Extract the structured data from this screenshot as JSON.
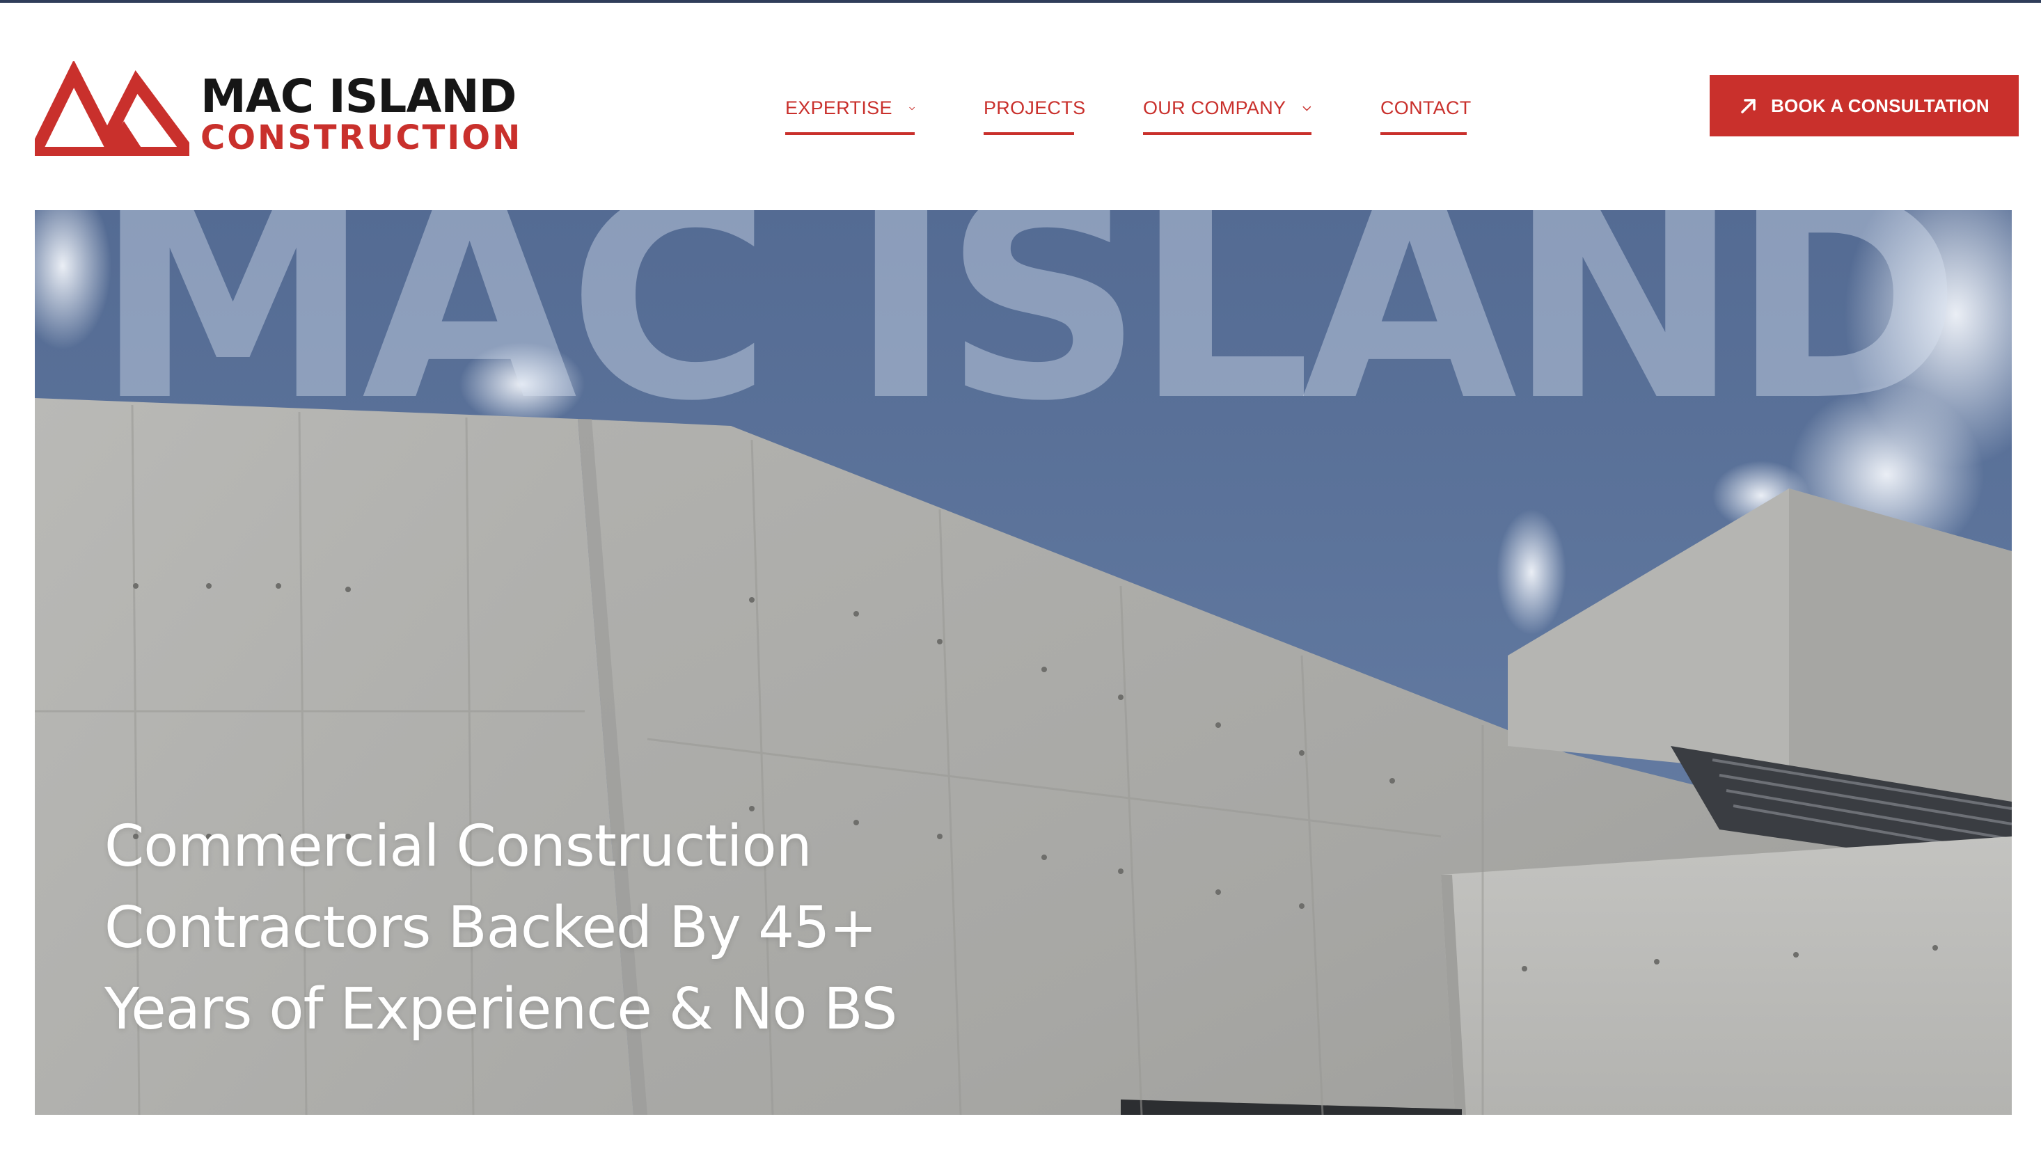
{
  "brand": {
    "name_line1": "MAC ISLAND",
    "name_line2": "CONSTRUCTION",
    "primary_color": "#c9302c",
    "dark_color": "#161616"
  },
  "nav": {
    "items": [
      {
        "label": "EXPERTISE",
        "has_dropdown": true
      },
      {
        "label": "PROJECTS",
        "has_dropdown": false
      },
      {
        "label": "OUR COMPANY",
        "has_dropdown": true
      },
      {
        "label": "CONTACT",
        "has_dropdown": false
      }
    ]
  },
  "cta": {
    "label": "BOOK A CONSULTATION",
    "icon": "arrow-up-right-icon"
  },
  "hero": {
    "watermark": "MAC ISLAND",
    "headline_lines": [
      "Commercial Construction",
      "Contractors Backed By 45+",
      "Years of Experience & No BS"
    ]
  }
}
